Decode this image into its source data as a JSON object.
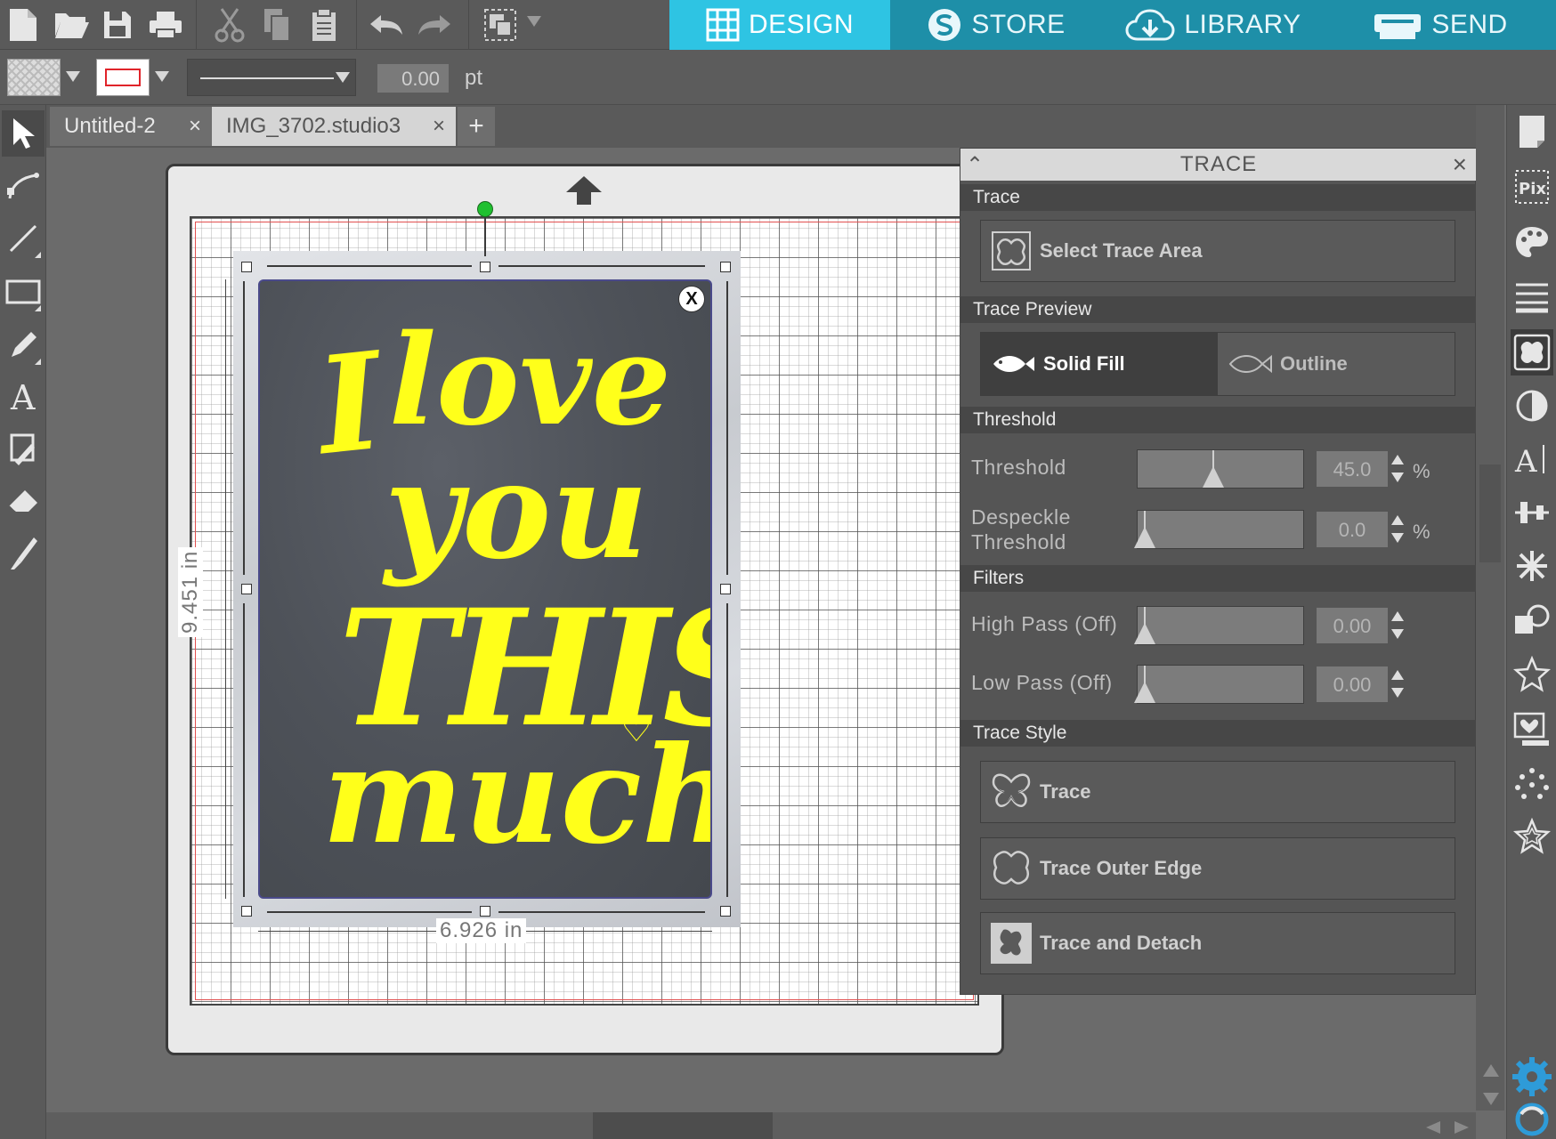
{
  "toolbar": {
    "buttons": [
      "new-document",
      "open",
      "save",
      "print",
      "cut",
      "copy",
      "paste",
      "undo",
      "redo",
      "group"
    ]
  },
  "nav": {
    "tabs": [
      {
        "label": "DESIGN",
        "icon": "grid-icon",
        "active": true
      },
      {
        "label": "STORE",
        "icon": "store-s-icon",
        "active": false
      },
      {
        "label": "LIBRARY",
        "icon": "cloud-download-icon",
        "active": false
      },
      {
        "label": "SEND",
        "icon": "plotter-icon",
        "active": false
      }
    ]
  },
  "options": {
    "line_width": "0.00",
    "line_unit": "pt",
    "line_color": "#e0242a"
  },
  "documents": {
    "tabs": [
      {
        "label": "Untitled-2",
        "close": "×",
        "active": false
      },
      {
        "label": "IMG_3702.studio3",
        "close": "×",
        "active": true
      }
    ],
    "add": "+"
  },
  "canvas": {
    "close_badge": "X",
    "quote": {
      "line1": "I",
      "line2": "love",
      "line3": "you",
      "line4": "THIS",
      "line5": "much",
      "heart": "♡"
    },
    "width_label": "6.926 in",
    "height_label": "9.451 in",
    "text_color": "#ffff1a"
  },
  "trace_panel": {
    "title": "TRACE",
    "sections": {
      "trace": "Trace",
      "preview": "Trace Preview",
      "threshold": "Threshold",
      "filters": "Filters",
      "style": "Trace Style"
    },
    "select_area": "Select Trace Area",
    "preview": {
      "solid": "Solid Fill",
      "outline": "Outline",
      "selected": "solid"
    },
    "threshold": {
      "label": "Threshold",
      "value": "45.0",
      "unit": "%",
      "fraction": 0.45
    },
    "despeckle": {
      "label_line1": "Despeckle",
      "label_line2": "Threshold",
      "value": "0.0",
      "unit": "%",
      "fraction": 0.0
    },
    "high_pass": {
      "label": "High Pass (Off)",
      "value": "0.00",
      "fraction": 0.0
    },
    "low_pass": {
      "label": "Low Pass (Off)",
      "value": "0.00",
      "fraction": 0.0
    },
    "style_buttons": {
      "trace": "Trace",
      "outer": "Trace Outer Edge",
      "detach": "Trace and Detach"
    }
  },
  "right_panels": [
    "page-setup-icon",
    "pixscan-icon",
    "fill-palette-icon",
    "line-style-icon",
    "trace-icon",
    "contrast-icon",
    "text-style-icon",
    "align-icon",
    "replicate-icon",
    "modify-icon",
    "star-icon",
    "library-heart-icon",
    "rhinestone-icon",
    "offset-star-icon"
  ]
}
